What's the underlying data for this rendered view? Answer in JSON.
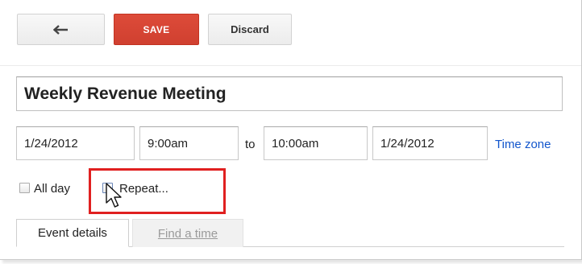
{
  "toolbar": {
    "back_icon": "arrow-left-icon",
    "save_label": "SAVE",
    "discard_label": "Discard"
  },
  "event": {
    "title": "Weekly Revenue Meeting",
    "start_date": "1/24/2012",
    "start_time": "9:00am",
    "to_label": "to",
    "end_time": "10:00am",
    "end_date": "1/24/2012",
    "time_zone_link": "Time zone"
  },
  "options": {
    "all_day_label": "All day",
    "all_day_checked": false,
    "repeat_label": "Repeat...",
    "repeat_checked": false
  },
  "tabs": [
    {
      "label": "Event details",
      "active": true
    },
    {
      "label": "Find a time",
      "active": false
    }
  ],
  "colors": {
    "save_button": "#dd4b39",
    "link": "#1155cc",
    "highlight": "#e02020"
  },
  "cursor_icon": "mouse-pointer-icon"
}
